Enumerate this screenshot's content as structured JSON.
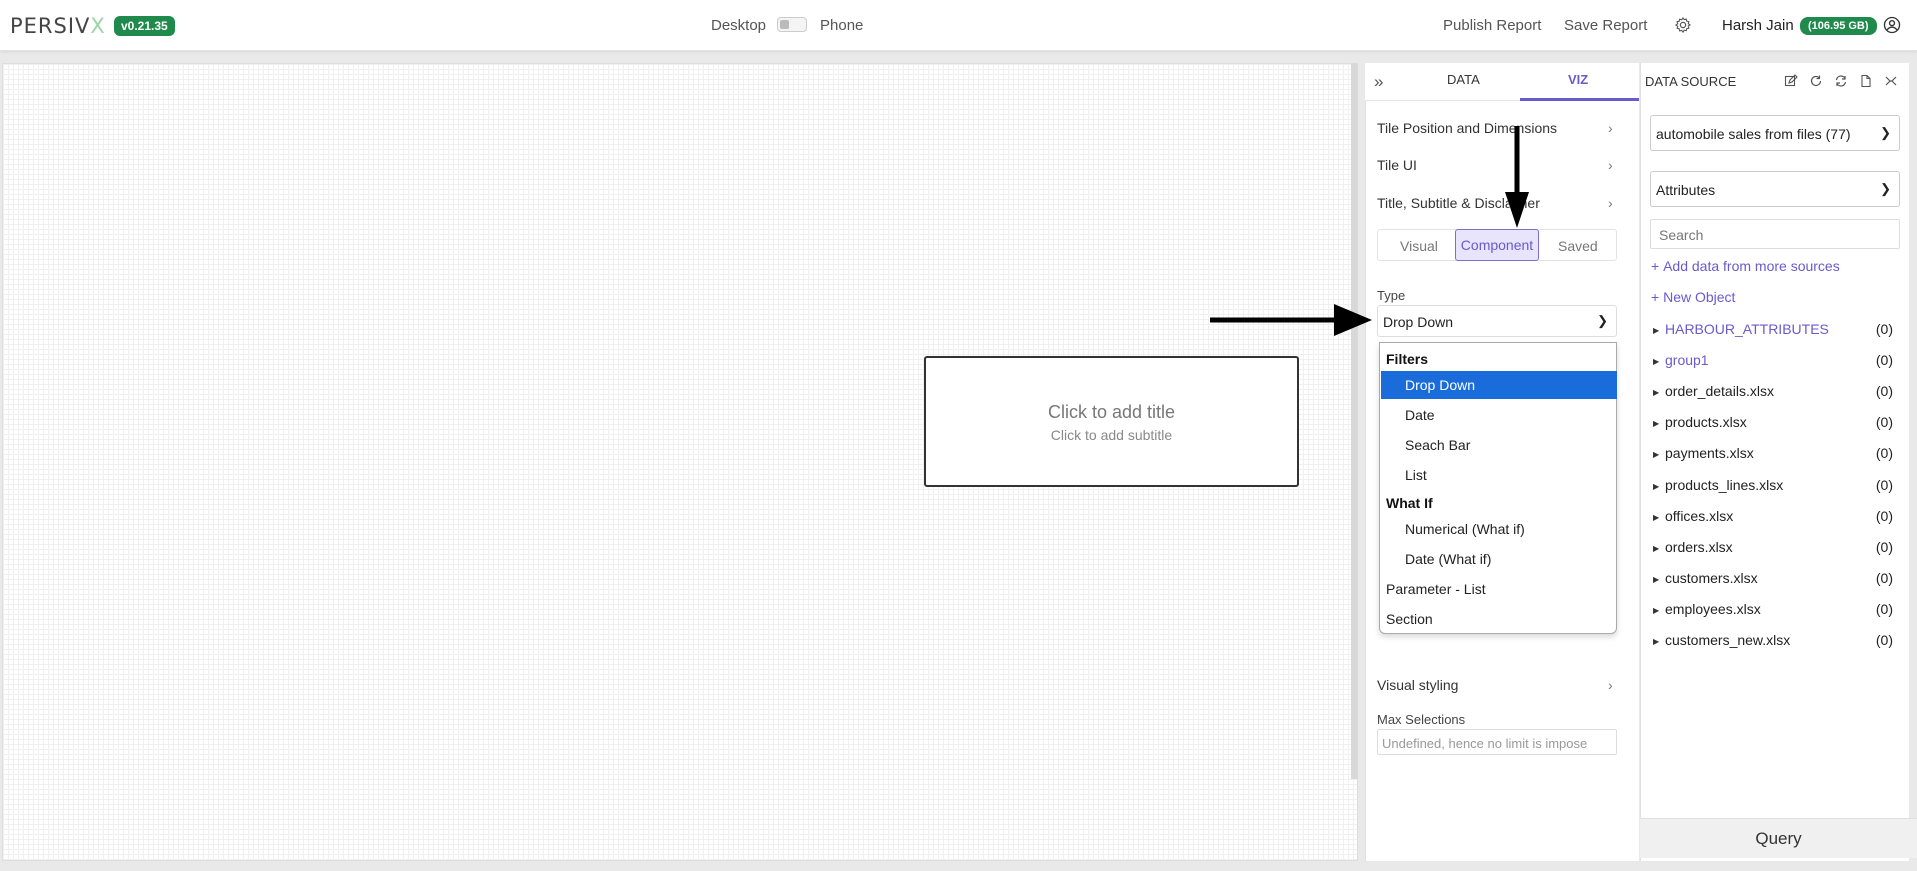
{
  "header": {
    "logo_main": "PERSIV",
    "logo_x": "X",
    "version": "v0.21.35",
    "mode_desktop": "Desktop",
    "mode_phone": "Phone",
    "publish_label": "Publish Report",
    "save_label": "Save Report",
    "user_name": "Harsh Jain",
    "storage": "(106.95 GB)"
  },
  "canvas": {
    "tile_title": "Click to add title",
    "tile_subtitle": "Click to add subtitle"
  },
  "panel": {
    "tabs": {
      "data": "DATA",
      "viz": "VIZ"
    },
    "accordion": [
      "Tile Position and Dimensions",
      "Tile UI",
      "Title, Subtitle & Disclaimer"
    ],
    "subtabs": {
      "visual": "Visual",
      "component": "Component",
      "saved": "Saved"
    },
    "type_label": "Type",
    "type_value": "Drop Down",
    "dropdown": {
      "group_filters": "Filters",
      "filters": [
        "Drop Down",
        "Date",
        "Seach Bar",
        "List"
      ],
      "group_whatif": "What If",
      "whatif": [
        "Numerical (What if)",
        "Date (What if)"
      ],
      "others": [
        "Parameter - List",
        "Section"
      ],
      "selected": "Drop Down"
    },
    "visual_styling": "Visual styling",
    "max_selections_label": "Max Selections",
    "max_selections_placeholder": "Undefined, hence no limit is impose"
  },
  "datasource": {
    "title": "DATA SOURCE",
    "source_select": "automobile sales from files (77)",
    "attr_select": "Attributes",
    "search_placeholder": "Search",
    "add_more": "Add data from more sources",
    "new_object": "New Object",
    "objects": [
      {
        "name": "HARBOUR_ATTRIBUTES",
        "count": "(0)"
      },
      {
        "name": "group1",
        "count": "(0)"
      },
      {
        "name": "order_details.xlsx",
        "count": "(0)"
      },
      {
        "name": "products.xlsx",
        "count": "(0)"
      },
      {
        "name": "payments.xlsx",
        "count": "(0)"
      },
      {
        "name": "products_lines.xlsx",
        "count": "(0)"
      },
      {
        "name": "offices.xlsx",
        "count": "(0)"
      },
      {
        "name": "orders.xlsx",
        "count": "(0)"
      },
      {
        "name": "customers.xlsx",
        "count": "(0)"
      },
      {
        "name": "employees.xlsx",
        "count": "(0)"
      },
      {
        "name": "customers_new.xlsx",
        "count": "(0)"
      }
    ],
    "query_label": "Query"
  },
  "colors": {
    "accent": "#6a5acd",
    "badge": "#1f8a4c",
    "selected": "#1a6cdb"
  }
}
